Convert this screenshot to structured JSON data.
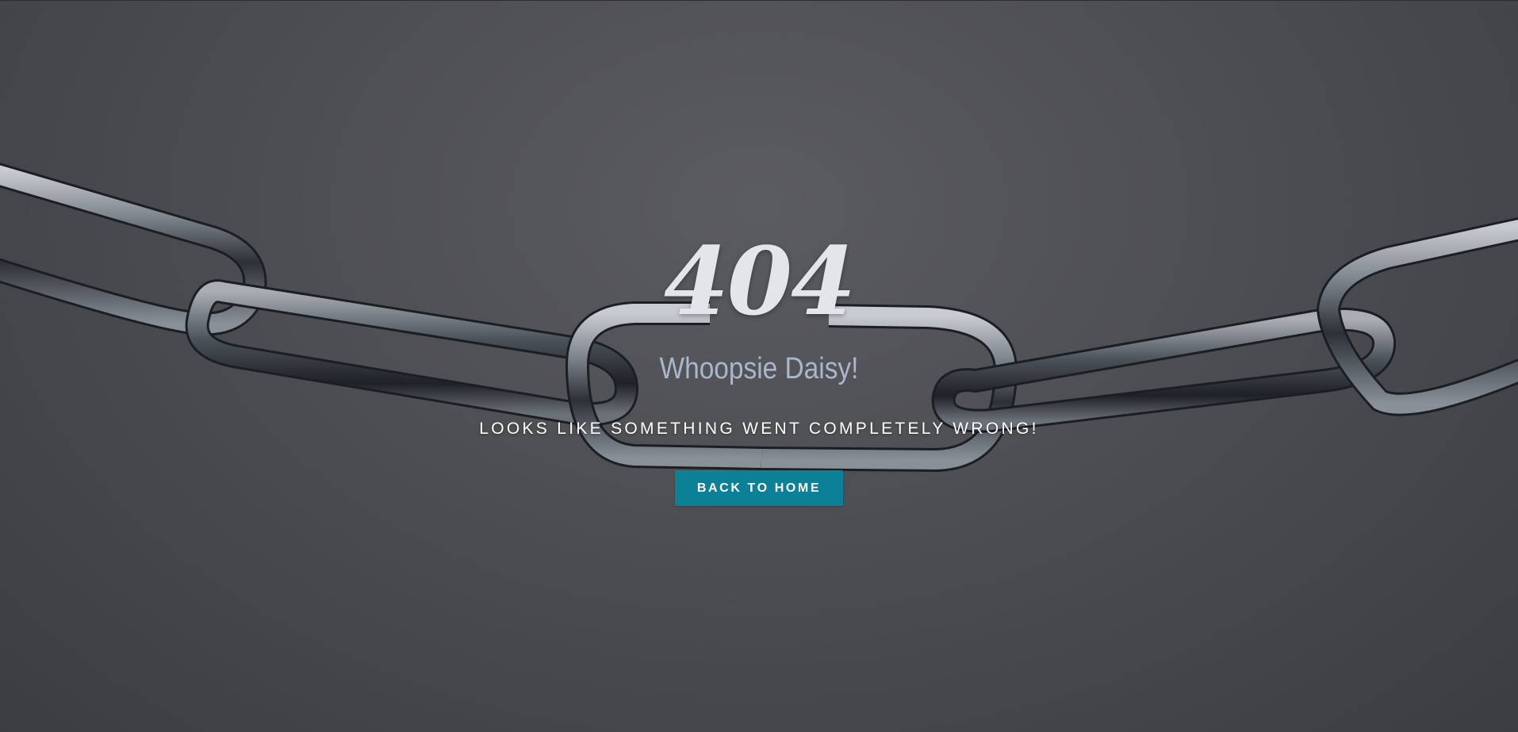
{
  "error": {
    "code": "404",
    "title": "Whoopsie Daisy!",
    "message": "LOOKS LIKE SOMETHING WENT COMPLETELY WRONG!"
  },
  "actions": {
    "back_home_label": "BACK TO HOME"
  },
  "colors": {
    "background": "#505155",
    "code_text": "#e4e5ea",
    "subtitle_text": "#a9b6cc",
    "button_background": "#0b8097",
    "button_text": "#ffffff"
  },
  "background_image": "broken-chain"
}
